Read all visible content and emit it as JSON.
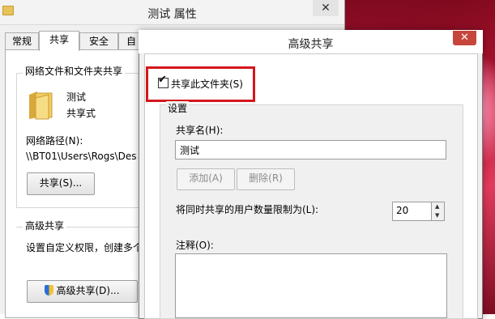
{
  "properties_window": {
    "title": "测试 属性",
    "close_glyph": "✕",
    "tabs": [
      {
        "label": "常规"
      },
      {
        "label": "共享"
      },
      {
        "label": "安全"
      },
      {
        "label": "自"
      }
    ],
    "network_share": {
      "group_title": "网络文件和文件夹共享",
      "folder_name": "测试",
      "folder_status": "共享式",
      "network_path_label": "网络路径(N):",
      "network_path_value": "\\\\BT01\\Users\\Rogs\\Des",
      "share_button": "共享(S)..."
    },
    "advanced_share": {
      "group_title": "高级共享",
      "description": "设置自定义权限，创建多个",
      "button": "高级共享(D)..."
    }
  },
  "advanced_dialog": {
    "title": "高级共享",
    "close_glyph": "✕",
    "share_checkbox_label": "共享此文件夹(S)",
    "share_checkbox_checked": true,
    "settings_title": "设置",
    "share_name_label": "共享名(H):",
    "share_name_value": "测试",
    "add_button": "添加(A)",
    "remove_button": "删除(R)",
    "limit_label": "将同时共享的用户数量限制为(L):",
    "limit_value": "20",
    "comment_label": "注释(O):",
    "highlight_color": "#d4171c"
  },
  "colors": {
    "close_button": "#c7463c",
    "folder_icon": "#e8c35a"
  }
}
